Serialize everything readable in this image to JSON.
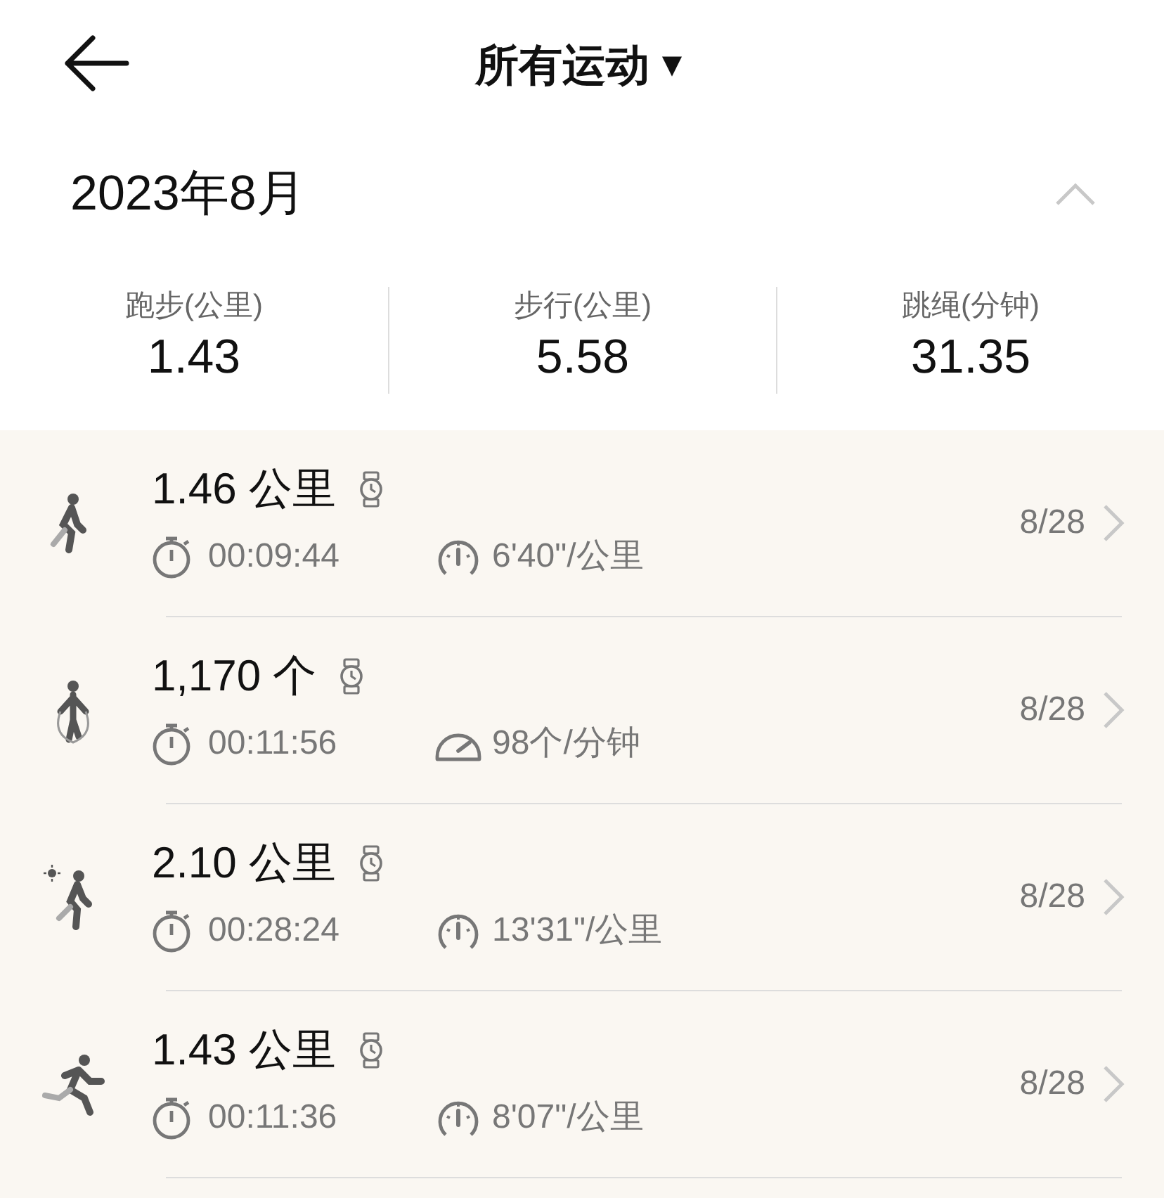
{
  "header": {
    "title": "所有运动",
    "dropdown_icon": "▼"
  },
  "month": {
    "label": "2023年8月",
    "expanded": true
  },
  "summary": [
    {
      "label": "跑步(公里)",
      "value": "1.43"
    },
    {
      "label": "步行(公里)",
      "value": "5.58"
    },
    {
      "label": "跳绳(分钟)",
      "value": "31.35"
    }
  ],
  "activities": [
    {
      "kind": "walk",
      "amount": "1.46 公里",
      "duration": "00:09:44",
      "rate": {
        "kind": "pace",
        "text": "6'40\"/公里"
      },
      "date": "8/28"
    },
    {
      "kind": "rope",
      "amount": "1,170 个",
      "duration": "00:11:56",
      "rate": {
        "kind": "speed",
        "text": "98个/分钟"
      },
      "date": "8/28"
    },
    {
      "kind": "outdoor_walk",
      "amount": "2.10 公里",
      "duration": "00:28:24",
      "rate": {
        "kind": "pace",
        "text": "13'31\"/公里"
      },
      "date": "8/28"
    },
    {
      "kind": "run",
      "amount": "1.43 公里",
      "duration": "00:11:36",
      "rate": {
        "kind": "pace",
        "text": "8'07\"/公里"
      },
      "date": "8/28"
    }
  ]
}
